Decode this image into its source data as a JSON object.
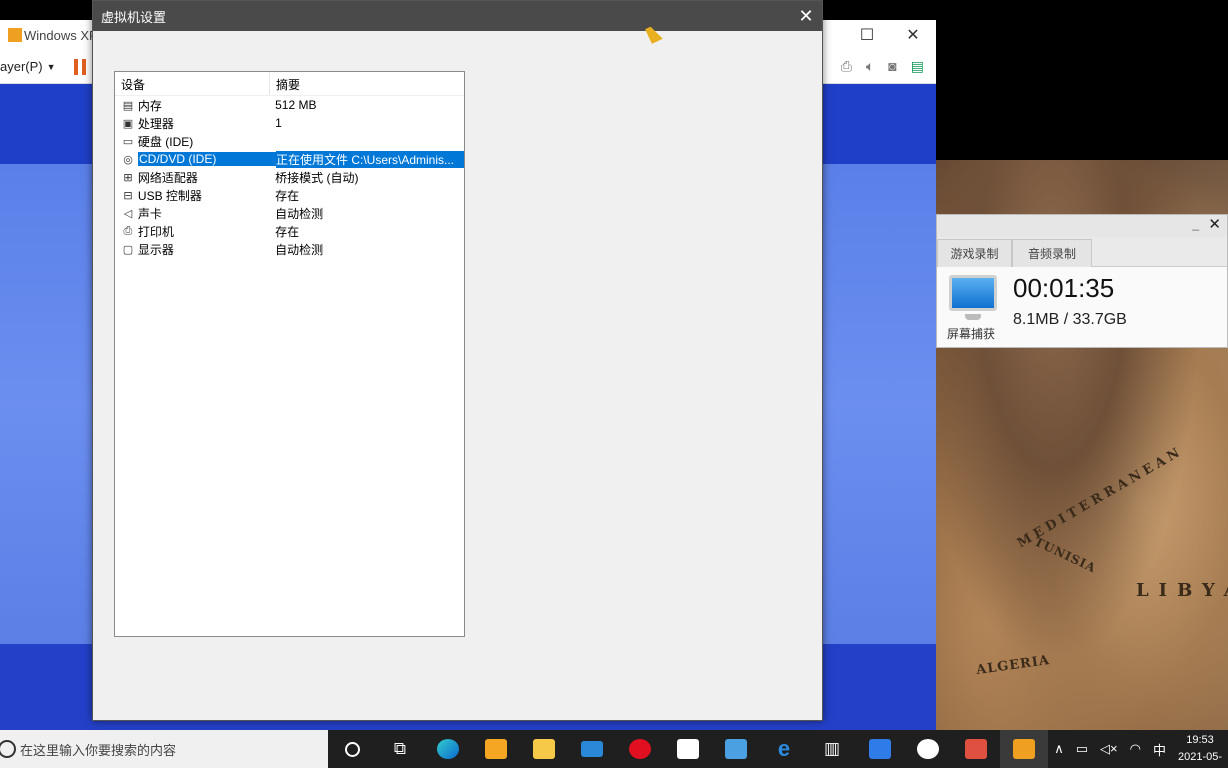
{
  "player": {
    "title": "Windows XP P",
    "menu_label": "ayer(P)",
    "maximize_glyph": "☐",
    "close_glyph": "✕",
    "toolbar_icons": [
      "printer-icon",
      "speaker-icon",
      "camera-icon",
      "note-icon"
    ]
  },
  "dialog": {
    "title": "虚拟机设置",
    "close_glyph": "✕",
    "columns": {
      "device": "设备",
      "summary": "摘要"
    },
    "devices": [
      {
        "icon": "memory-icon",
        "glyph": "▤",
        "name": "内存",
        "summary": "512 MB",
        "selected": false
      },
      {
        "icon": "cpu-icon",
        "glyph": "▣",
        "name": "处理器",
        "summary": "1",
        "selected": false
      },
      {
        "icon": "harddisk-icon",
        "glyph": "▭",
        "name": "硬盘 (IDE)",
        "summary": "",
        "selected": false
      },
      {
        "icon": "cd-dvd-icon",
        "glyph": "◎",
        "name": "CD/DVD (IDE)",
        "summary": "正在使用文件 C:\\Users\\Adminis...",
        "selected": true
      },
      {
        "icon": "network-icon",
        "glyph": "⊞",
        "name": "网络适配器",
        "summary": "桥接模式 (自动)",
        "selected": false
      },
      {
        "icon": "usb-icon",
        "glyph": "⊟",
        "name": "USB 控制器",
        "summary": "存在",
        "selected": false
      },
      {
        "icon": "sound-icon",
        "glyph": "◁",
        "name": "声卡",
        "summary": "自动检测",
        "selected": false
      },
      {
        "icon": "printer-icon",
        "glyph": "⎙",
        "name": "打印机",
        "summary": "存在",
        "selected": false
      },
      {
        "icon": "display-icon",
        "glyph": "▢",
        "name": "显示器",
        "summary": "自动检测",
        "selected": false
      }
    ]
  },
  "recorder": {
    "close_glyph": "✕",
    "min_glyph": "_",
    "tabs": [
      "游戏录制",
      "音频录制"
    ],
    "capture_label": "屏幕捕获",
    "time": "00:01:35",
    "size": "8.1MB / 33.7GB"
  },
  "map_labels": [
    "TUNISIA",
    "ALGERIA",
    "MEDITERRANEAN",
    "LIBYA"
  ],
  "taskbar": {
    "search_placeholder": "在这里输入你要搜索的内容",
    "apps": [
      "cortana-icon",
      "task-view-icon",
      "edge-icon",
      "media-player-icon",
      "file-explorer-icon",
      "mail-icon",
      "opera-icon",
      "calendar-icon",
      "input-method-icon",
      "ie-icon",
      "library-icon",
      "feishu-icon",
      "baidu-netdisk-icon",
      "photo-icon",
      "vmware-icon"
    ],
    "tray_ime": "中",
    "time": "19:53",
    "date": "2021-05-"
  }
}
